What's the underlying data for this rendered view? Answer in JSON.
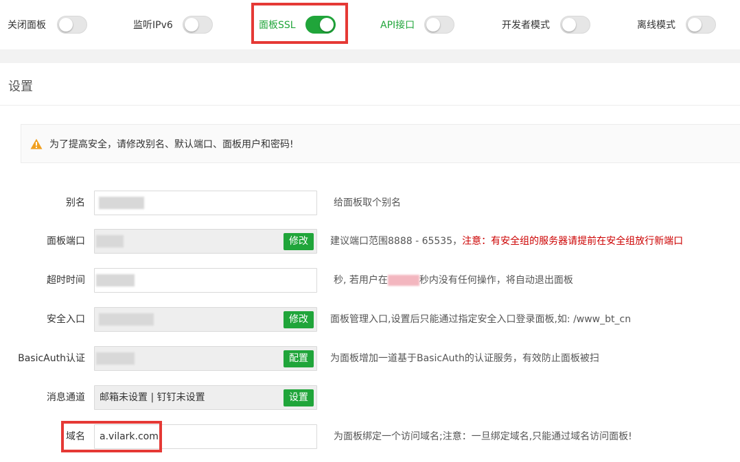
{
  "toggles": [
    {
      "label": "关闭面板",
      "on": false
    },
    {
      "label": "监听IPv6",
      "on": false
    },
    {
      "label": "面板SSL",
      "on": true
    },
    {
      "label": "API接口",
      "on": false
    },
    {
      "label": "开发者模式",
      "on": false
    },
    {
      "label": "离线模式",
      "on": false
    }
  ],
  "settings": {
    "title": "设置",
    "alert": "为了提高安全，请修改别名、默认端口、面板用户和密码!"
  },
  "rows": {
    "alias": {
      "label": "别名",
      "hint": "给面板取个别名"
    },
    "port": {
      "label": "面板端口",
      "button": "修改",
      "hint": "建议端口范围8888 - 65535，",
      "warning": "注意：有安全组的服务器请提前在安全组放行新端口"
    },
    "timeout": {
      "label": "超时时间",
      "hint_before": "秒, 若用户在",
      "hint_after": "秒内没有任何操作，将自动退出面板"
    },
    "entrance": {
      "label": "安全入口",
      "button": "修改",
      "hint": "面板管理入口,设置后只能通过指定安全入口登录面板,如: /www_bt_cn"
    },
    "basicauth": {
      "label": "BasicAuth认证",
      "button": "配置",
      "hint": "为面板增加一道基于BasicAuth的认证服务，有效防止面板被扫"
    },
    "message": {
      "label": "消息通道",
      "value": "邮箱未设置 | 钉钉未设置",
      "button": "设置"
    },
    "domain": {
      "label": "域名",
      "value": "a.vilark.com",
      "hint": "为面板绑定一个访问域名;注意：一旦绑定域名,只能通过域名访问面板!"
    }
  },
  "colors": {
    "accent": "#20a53a",
    "highlight": "#e53935",
    "warning_text": "#cc0000"
  }
}
